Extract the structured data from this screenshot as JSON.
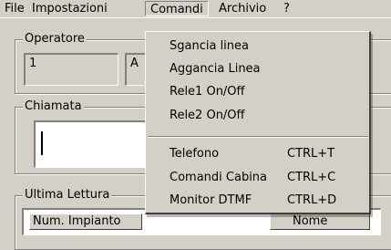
{
  "menubar": {
    "items": [
      {
        "label": "File"
      },
      {
        "label": "Impostazioni"
      },
      {
        "label": "Comandi"
      },
      {
        "label": "Archivio"
      },
      {
        "label": "?"
      }
    ]
  },
  "operatore": {
    "legend": "Operatore",
    "field1_value": "1",
    "field2_value": "A"
  },
  "chiamata": {
    "legend": "Chiamata"
  },
  "ultima_lettura": {
    "legend": "Ultima Lettura",
    "columns": [
      "Num. Impianto",
      "Nome"
    ]
  },
  "comandi_menu": {
    "items": [
      {
        "label": "Sgancia linea",
        "shortcut": ""
      },
      {
        "label": "Aggancia Linea",
        "shortcut": ""
      },
      {
        "label": "Rele1 On/Off",
        "shortcut": ""
      },
      {
        "label": "Rele2 On/Off",
        "shortcut": ""
      },
      {
        "label": "Telefono",
        "shortcut": "CTRL+T"
      },
      {
        "label": "Comandi Cabina",
        "shortcut": "CTRL+C"
      },
      {
        "label": "Monitor DTMF",
        "shortcut": "CTRL+D"
      }
    ]
  }
}
